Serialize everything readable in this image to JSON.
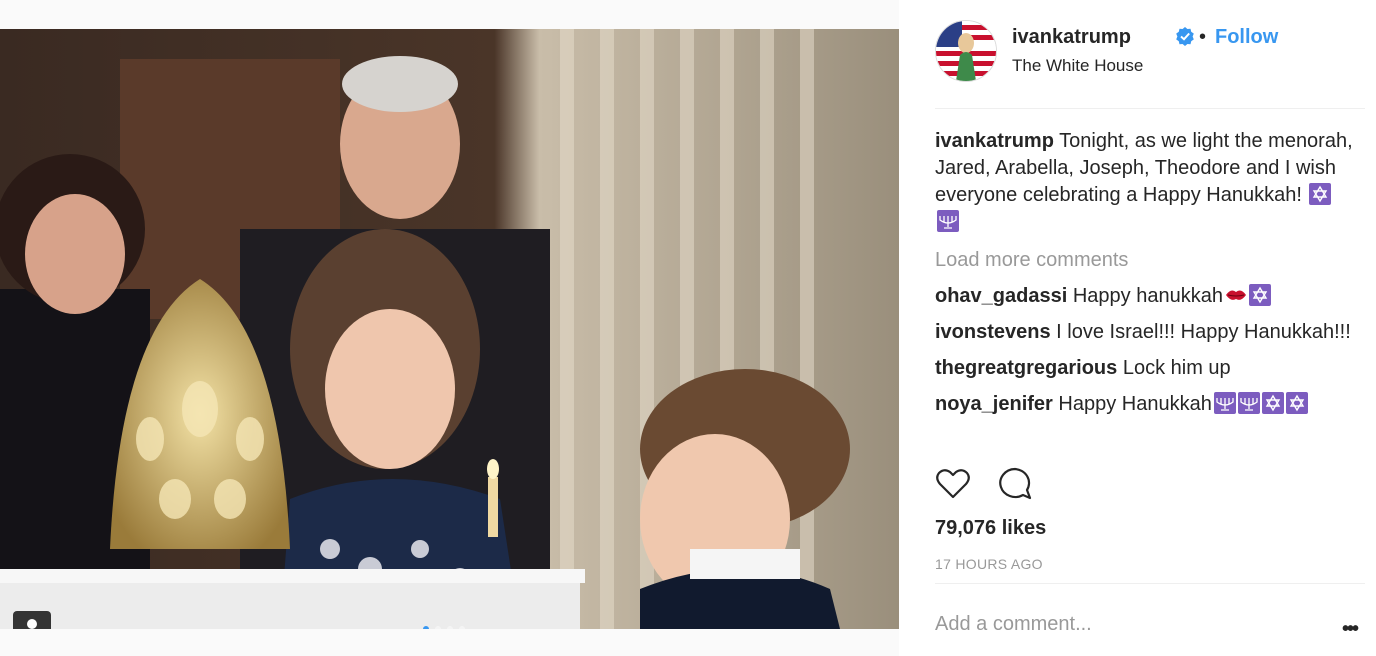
{
  "post": {
    "username": "ivankatrump",
    "follow_label": "Follow",
    "separator": "•",
    "location": "The White House",
    "caption": {
      "user": "ivankatrump",
      "text": "Tonight, as we light the menorah, Jared, Arabella, Joseph, Theodore and I wish everyone celebrating a Happy Hanukkah!",
      "emojis": [
        "star-of-david",
        "menorah"
      ]
    },
    "load_more": "Load more comments",
    "comments": [
      {
        "user": "ohav_gadassi",
        "text": "Happy hanukkah",
        "emojis": [
          "lips",
          "star-of-david"
        ]
      },
      {
        "user": "ivonstevens",
        "text": "I love Israel!!! Happy Hanukkah!!!",
        "emojis": []
      },
      {
        "user": "thegreatgregarious",
        "text": "Lock him up",
        "emojis": []
      },
      {
        "user": "noya_jenifer",
        "text": "Happy Hanukkah",
        "emojis": [
          "menorah",
          "menorah",
          "star-of-david",
          "star-of-david"
        ]
      }
    ],
    "likes": "79,076 likes",
    "timestamp": "17 HOURS AGO",
    "add_comment_placeholder": "Add a comment...",
    "more_options": "•••",
    "carousel": {
      "count": 4,
      "active_index": 0
    },
    "colors": {
      "link": "#3897f0",
      "muted": "#999999",
      "text": "#262626",
      "emoji_bg": "#7c5cbf"
    }
  }
}
